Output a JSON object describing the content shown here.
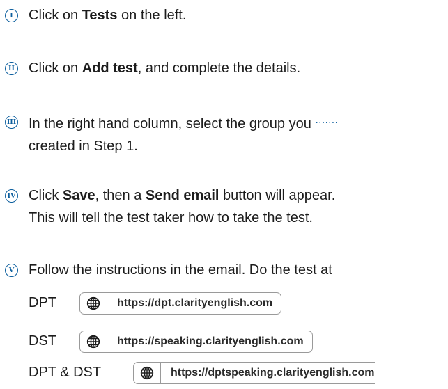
{
  "steps": [
    {
      "numeral": "I",
      "parts": [
        {
          "t": "Click on "
        },
        {
          "b": "Tests"
        },
        {
          "t": " on the left."
        }
      ]
    },
    {
      "numeral": "II",
      "parts": [
        {
          "t": "Click on "
        },
        {
          "b": "Add test"
        },
        {
          "t": ", and complete the details."
        }
      ]
    },
    {
      "numeral": "III",
      "line1": "In the right hand column, select the group you",
      "dots": "·······",
      "line2": "created in Step 1."
    },
    {
      "numeral": "IV",
      "parts": [
        {
          "t": "Click "
        },
        {
          "b": "Save"
        },
        {
          "t": ", then a "
        },
        {
          "b": "Send email"
        },
        {
          "t": " button will appear."
        }
      ],
      "line2": "This will tell the test taker how to take the test."
    },
    {
      "numeral": "V",
      "text": "Follow the instructions in the email. Do the test at"
    }
  ],
  "links": [
    {
      "label": "DPT",
      "icon": "globe-icon",
      "url": "https://dpt.clarityenglish.com"
    },
    {
      "label": "DST",
      "icon": "globe-icon",
      "url": "https://speaking.clarityenglish.com"
    },
    {
      "label": "DPT & DST",
      "icon": "globe-icon",
      "url": "https://dptspeaking.clarityenglish.com"
    }
  ],
  "colors": {
    "accent": "#0d5f9e",
    "text": "#1c1c1c",
    "border": "#9a9a9a"
  }
}
